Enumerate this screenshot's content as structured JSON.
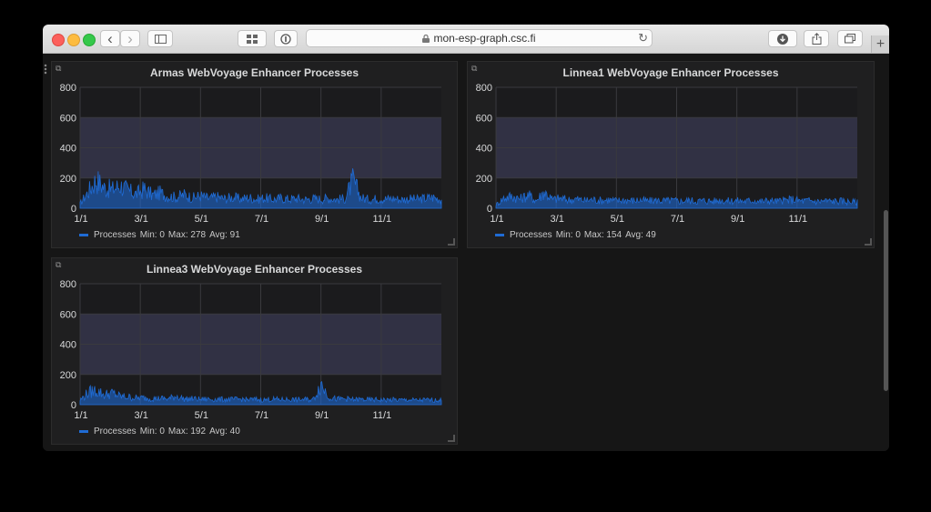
{
  "browser": {
    "url": "mon-esp-graph.csc.fi",
    "buttons": {
      "back": "‹",
      "forward": "›",
      "new_tab": "+"
    }
  },
  "panels": [
    {
      "title": "Armas WebVoyage Enhancer Processes",
      "legend": {
        "series": "Processes",
        "min": "Min: 0",
        "max": "Max: 278",
        "avg": "Avg: 91"
      }
    },
    {
      "title": "Linnea1 WebVoyage Enhancer Processes",
      "legend": {
        "series": "Processes",
        "min": "Min: 0",
        "max": "Max: 154",
        "avg": "Avg: 49"
      }
    },
    {
      "title": "Linnea3 WebVoyage Enhancer Processes",
      "legend": {
        "series": "Processes",
        "min": "Min: 0",
        "max": "Max: 192",
        "avg": "Avg: 40"
      }
    }
  ],
  "colors": {
    "series": "#1f6bd4",
    "threshold_band": "#3a3a52",
    "panel_bg": "#1f1f20"
  },
  "chart_data": [
    {
      "type": "area",
      "title": "Armas WebVoyage Enhancer Processes",
      "x_ticks": [
        "1/1",
        "3/1",
        "5/1",
        "7/1",
        "9/1",
        "11/1"
      ],
      "y_ticks": [
        "0",
        "200",
        "400",
        "600",
        "800"
      ],
      "ylim": [
        0,
        800
      ],
      "threshold_band": [
        200,
        600
      ],
      "series": [
        {
          "name": "Processes",
          "stats": {
            "min": 0,
            "max": 278,
            "avg": 91
          },
          "profile": [
            40,
            150,
            260,
            190,
            170,
            210,
            160,
            130,
            175,
            120,
            140,
            110,
            100,
            125,
            95,
            115,
            90,
            105,
            88,
            100,
            85,
            98,
            82,
            95,
            80,
            92,
            84,
            90,
            80,
            88,
            85,
            92,
            80,
            90,
            255,
            95,
            80,
            88,
            85,
            90,
            80,
            86,
            82,
            90,
            100,
            80
          ]
        }
      ]
    },
    {
      "type": "area",
      "title": "Linnea1 WebVoyage Enhancer Processes",
      "x_ticks": [
        "1/1",
        "3/1",
        "5/1",
        "7/1",
        "9/1",
        "11/1"
      ],
      "y_ticks": [
        "0",
        "200",
        "400",
        "600",
        "800"
      ],
      "ylim": [
        0,
        800
      ],
      "threshold_band": [
        200,
        600
      ],
      "series": [
        {
          "name": "Processes",
          "stats": {
            "min": 0,
            "max": 154,
            "avg": 49
          },
          "profile": [
            30,
            95,
            110,
            85,
            120,
            70,
            150,
            80,
            90,
            75,
            85,
            70,
            80,
            72,
            78,
            68,
            75,
            70,
            74,
            66,
            72,
            68,
            70,
            65,
            72,
            66,
            70,
            64,
            75,
            66,
            70,
            64,
            72,
            62,
            70,
            64,
            72,
            80,
            66,
            70,
            62,
            68,
            64,
            66,
            60,
            55
          ]
        }
      ]
    },
    {
      "type": "area",
      "title": "Linnea3 WebVoyage Enhancer Processes",
      "x_ticks": [
        "1/1",
        "3/1",
        "5/1",
        "7/1",
        "9/1",
        "11/1"
      ],
      "y_ticks": [
        "0",
        "200",
        "400",
        "600",
        "800"
      ],
      "ylim": [
        0,
        800
      ],
      "threshold_band": [
        200,
        600
      ],
      "series": [
        {
          "name": "Processes",
          "stats": {
            "min": 0,
            "max": 192,
            "avg": 40
          },
          "profile": [
            40,
            110,
            130,
            90,
            105,
            75,
            70,
            60,
            62,
            55,
            58,
            52,
            80,
            50,
            55,
            48,
            52,
            46,
            50,
            48,
            50,
            46,
            48,
            44,
            50,
            46,
            48,
            45,
            48,
            44,
            190,
            70,
            50,
            55,
            46,
            48,
            44,
            46,
            42,
            45,
            42,
            44,
            40,
            43,
            42,
            40
          ]
        }
      ]
    }
  ]
}
